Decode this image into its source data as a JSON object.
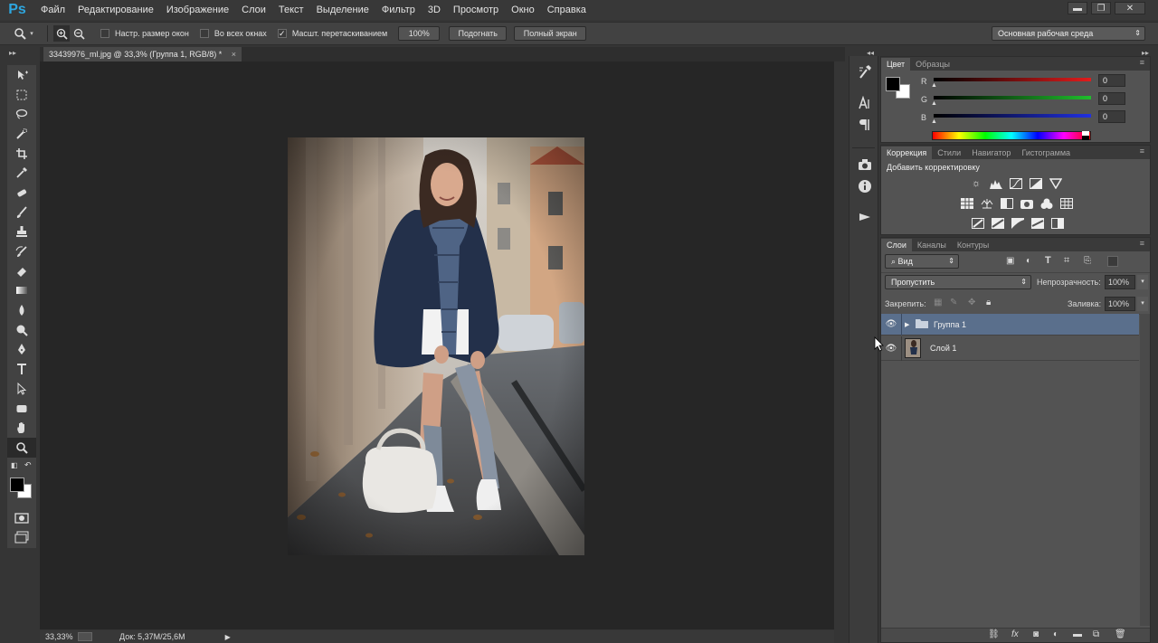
{
  "app": {
    "logo": "Ps"
  },
  "menu": [
    "Файл",
    "Редактирование",
    "Изображение",
    "Слои",
    "Текст",
    "Выделение",
    "Фильтр",
    "3D",
    "Просмотр",
    "Окно",
    "Справка"
  ],
  "window_controls": {
    "minimize": "▬",
    "restore": "❐",
    "close": "✕"
  },
  "options": {
    "resize_windows": "Настр. размер окон",
    "all_windows": "Во всех окнах",
    "scrubby_zoom": "Масшт. перетаскиванием",
    "zoom_100": "100%",
    "fit": "Подогнать",
    "fullscreen": "Полный экран",
    "workspace": "Основная рабочая среда"
  },
  "document": {
    "tab_title": "33439976_ml.jpg @ 33,3% (Группа 1, RGB/8) *",
    "zoom": "33,33%",
    "doc_size": "Док: 5,37M/25,6M"
  },
  "color_panel": {
    "tabs": [
      "Цвет",
      "Образцы"
    ],
    "channels": [
      {
        "label": "R",
        "value": "0",
        "color": "#d62020"
      },
      {
        "label": "G",
        "value": "0",
        "color": "#1fae2c"
      },
      {
        "label": "B",
        "value": "0",
        "color": "#2030d0"
      }
    ]
  },
  "adjustments_panel": {
    "tabs": [
      "Коррекция",
      "Стили",
      "Навигатор",
      "Гистограмма"
    ],
    "title": "Добавить корректировку",
    "row1_icons": [
      "brightness-icon",
      "levels-icon",
      "curves-icon",
      "exposure-icon",
      "vibrance-icon"
    ],
    "row2_icons": [
      "hue-saturation-icon",
      "color-balance-icon",
      "black-white-icon",
      "photo-filter-icon",
      "channel-mixer-icon",
      "color-lookup-icon"
    ],
    "row3_icons": [
      "invert-icon",
      "posterize-icon",
      "threshold-icon",
      "selective-color-icon",
      "gradient-map-icon"
    ]
  },
  "layers_panel": {
    "tabs": [
      "Слои",
      "Каналы",
      "Контуры"
    ],
    "filter_kind": "Вид",
    "blend_mode": "Пропустить",
    "opacity_label": "Непрозрачность:",
    "opacity_value": "100%",
    "lock_label": "Закрепить:",
    "fill_label": "Заливка:",
    "fill_value": "100%",
    "layers": [
      {
        "name": "Группа 1",
        "type": "group",
        "selected": true
      },
      {
        "name": "Слой 1",
        "type": "pixel",
        "selected": false
      }
    ]
  },
  "colors": {
    "accent": "#2ea7e0",
    "selected_layer": "#5a6f8c",
    "canvas_bg": "#262626"
  }
}
